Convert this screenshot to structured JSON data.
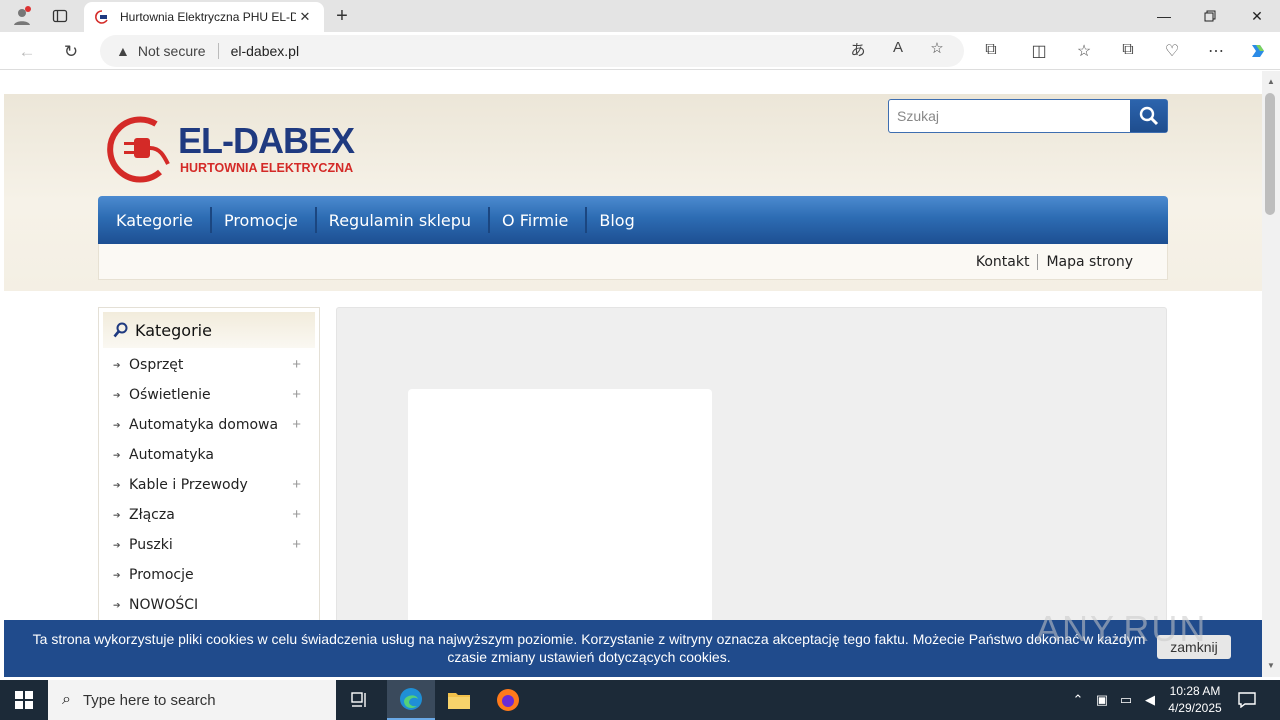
{
  "browser": {
    "tab_title": "Hurtownia Elektryczna PHU EL-D",
    "security_label": "Not secure",
    "url": "el-dabex.pl"
  },
  "site": {
    "logo_main": "EL-DABEX",
    "logo_sub": "HURTOWNIA ELEKTRYCZNA",
    "search_placeholder": "Szukaj",
    "nav": [
      "Kategorie",
      "Promocje",
      "Regulamin sklepu",
      "O Firmie",
      "Blog"
    ],
    "sub_links": [
      "Kontakt",
      "Mapa strony"
    ],
    "sidebar": {
      "title": "Kategorie",
      "items": [
        {
          "label": "Osprzęt",
          "expandable": "+"
        },
        {
          "label": "Oświetlenie",
          "expandable": "+"
        },
        {
          "label": "Automatyka domowa",
          "expandable": "+"
        },
        {
          "label": "Automatyka",
          "expandable": ""
        },
        {
          "label": "Kable i Przewody",
          "expandable": "+"
        },
        {
          "label": "Złącza",
          "expandable": "+"
        },
        {
          "label": "Puszki",
          "expandable": "+"
        },
        {
          "label": "Promocje",
          "expandable": ""
        },
        {
          "label": "NOWOŚCI",
          "expandable": ""
        }
      ]
    }
  },
  "cookie": {
    "text": "Ta strona wykorzystuje pliki cookies w celu świadczenia usług na najwyższym poziomie. Korzystanie z witryny oznacza akceptację tego faktu. Możecie Państwo dokonać w każdym czasie zmiany ustawień dotyczących cookies.",
    "button": "zamknij"
  },
  "watermark": "ANY.RUN",
  "taskbar": {
    "search_placeholder": "Type here to search",
    "time": "10:28 AM",
    "date": "4/29/2025"
  },
  "colors": {
    "nav_blue": "#2d6cb3",
    "logo_blue": "#1f3a80",
    "logo_red": "#d42a27",
    "cookie_bg": "#204b8c"
  }
}
